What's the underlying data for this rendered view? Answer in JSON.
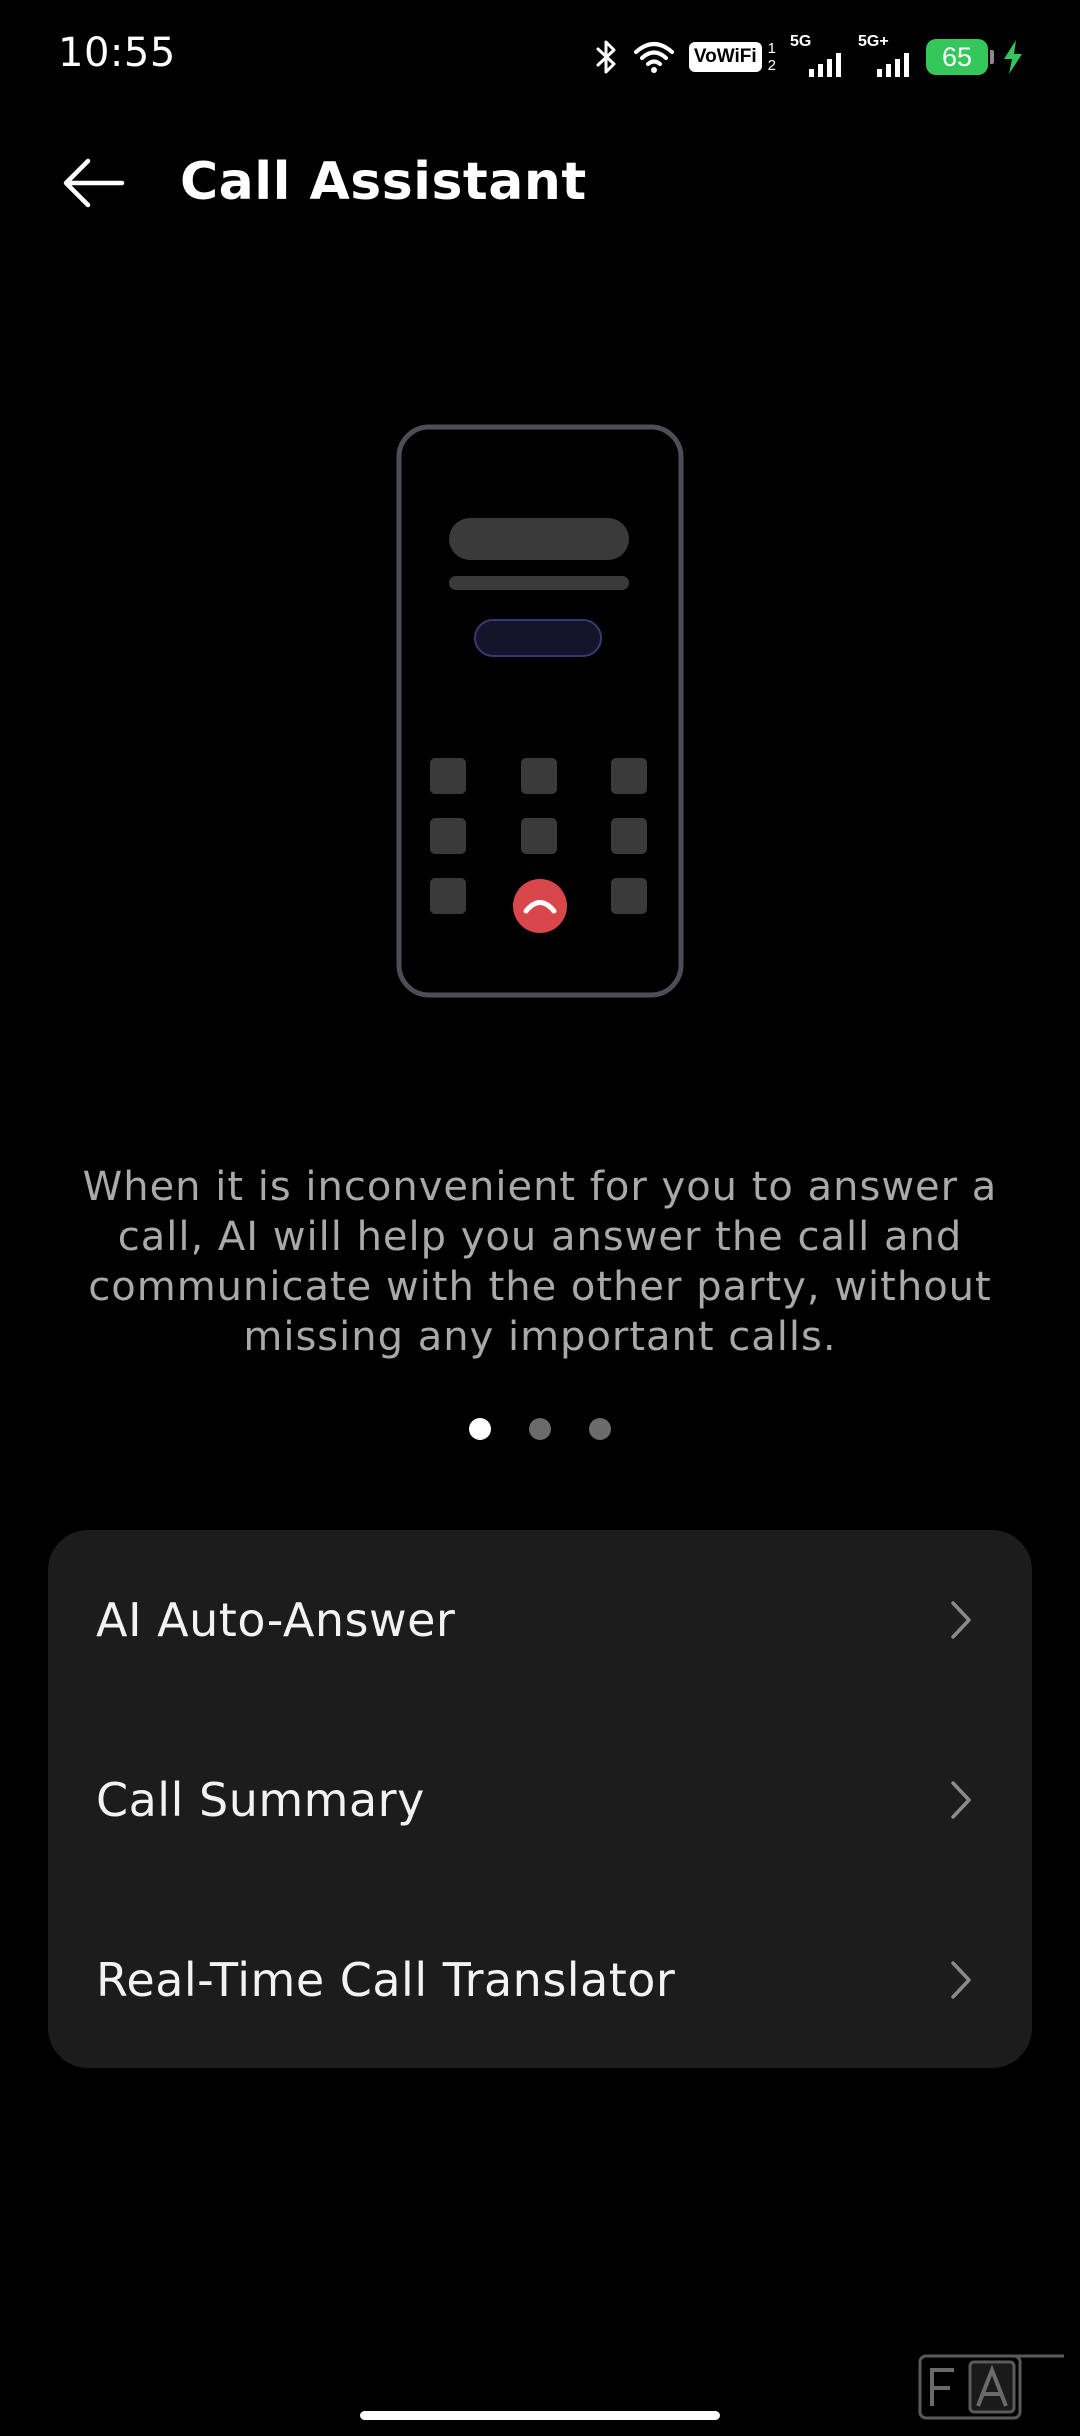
{
  "status_bar": {
    "time": "10:55",
    "vowifi_label": "VoWiFi",
    "sim_digits": [
      "1",
      "2"
    ],
    "network1": "5G",
    "network2": "5G+",
    "battery_level": "65",
    "battery_color": "#34c759"
  },
  "header": {
    "title": "Call Assistant",
    "back_icon": "arrow-left-icon"
  },
  "feature_intro": {
    "description": "When it is inconvenient for you to answer a call, AI will help you answer the call and communicate with the other party, without missing any important calls.",
    "pager": {
      "page_count": 3,
      "active_index": 0
    }
  },
  "menu": {
    "items": [
      {
        "label": "AI Auto-Answer"
      },
      {
        "label": "Call Summary"
      },
      {
        "label": "Real-Time Call Translator"
      }
    ]
  },
  "watermark": {
    "letters": "FA"
  },
  "colors": {
    "background": "#000000",
    "card": "#1c1c1c",
    "description_text": "#a9a9a9",
    "hangup_red": "#d9474b",
    "accent_pill": "#3a3870"
  }
}
